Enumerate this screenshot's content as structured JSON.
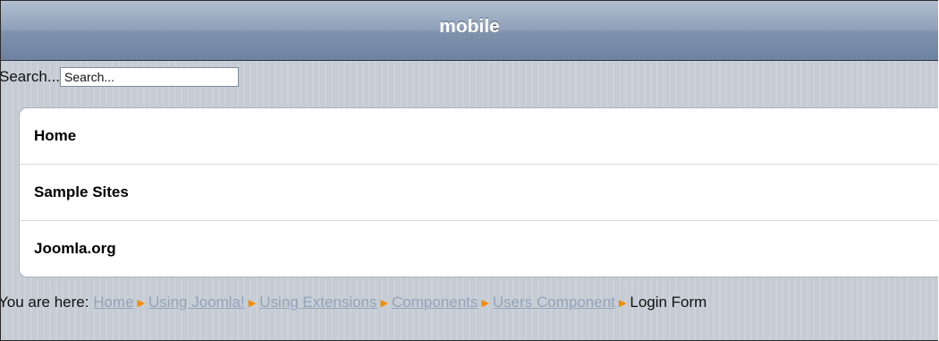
{
  "header": {
    "title": "mobile"
  },
  "search": {
    "label": "Search...",
    "placeholder": "Search..."
  },
  "menu": {
    "items": [
      {
        "label": "Home"
      },
      {
        "label": "Sample Sites"
      },
      {
        "label": "Joomla.org"
      }
    ]
  },
  "breadcrumb": {
    "prefix": "You are here:",
    "separator_icon": "arrow-right-icon",
    "links": [
      {
        "label": "Home"
      },
      {
        "label": "Using Joomla!"
      },
      {
        "label": "Using Extensions"
      },
      {
        "label": "Components"
      },
      {
        "label": "Users Component"
      }
    ],
    "current": "Login Form"
  },
  "colors": {
    "toolbar": "#7f93ad",
    "link": "#93a3b8",
    "separator": "#f28c00"
  }
}
